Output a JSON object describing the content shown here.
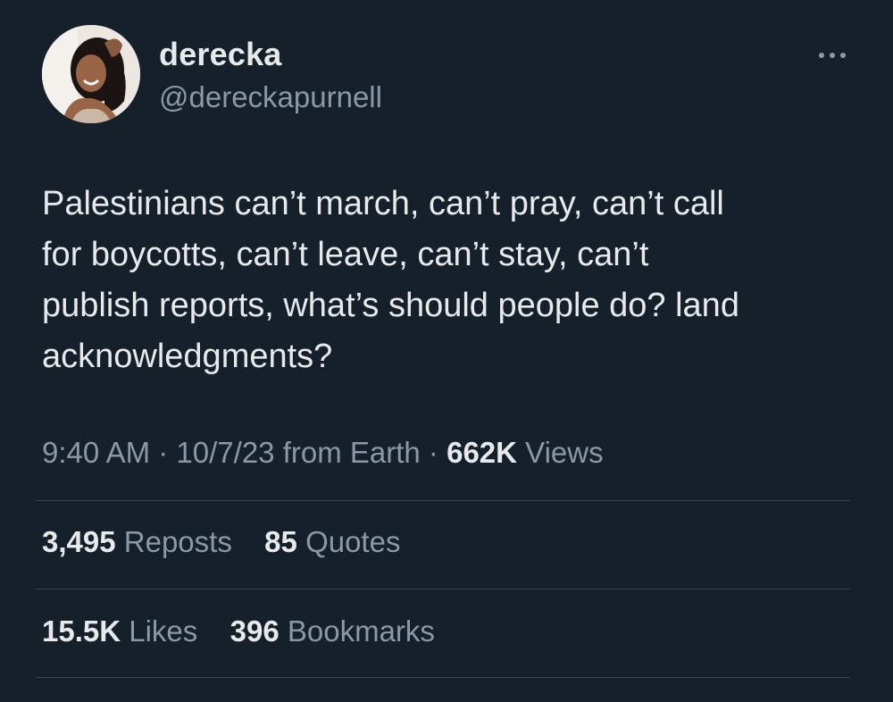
{
  "author": {
    "display_name": "derecka",
    "handle": "@dereckapurnell"
  },
  "tweet": {
    "text": "Palestinians can’t march, can’t pray, can’t call\nfor boycotts, can’t leave, can’t stay, can’t\npublish reports, what’s should people do? land\nacknowledgments?"
  },
  "meta": {
    "time": "9:40 AM",
    "separator": "·",
    "date": "10/7/23",
    "source": "from Earth",
    "views_count": "662K",
    "views_label": "Views"
  },
  "stats": {
    "reposts_count": "3,495",
    "reposts_label": "Reposts",
    "quotes_count": "85",
    "quotes_label": "Quotes",
    "likes_count": "15.5K",
    "likes_label": "Likes",
    "bookmarks_count": "396",
    "bookmarks_label": "Bookmarks"
  },
  "icons": {
    "more": "more-horizontal-icon"
  },
  "colors": {
    "background": "#15202b",
    "primary_text": "#e7e9ea",
    "secondary_text": "#8b98a5",
    "divider": "#38444d"
  }
}
